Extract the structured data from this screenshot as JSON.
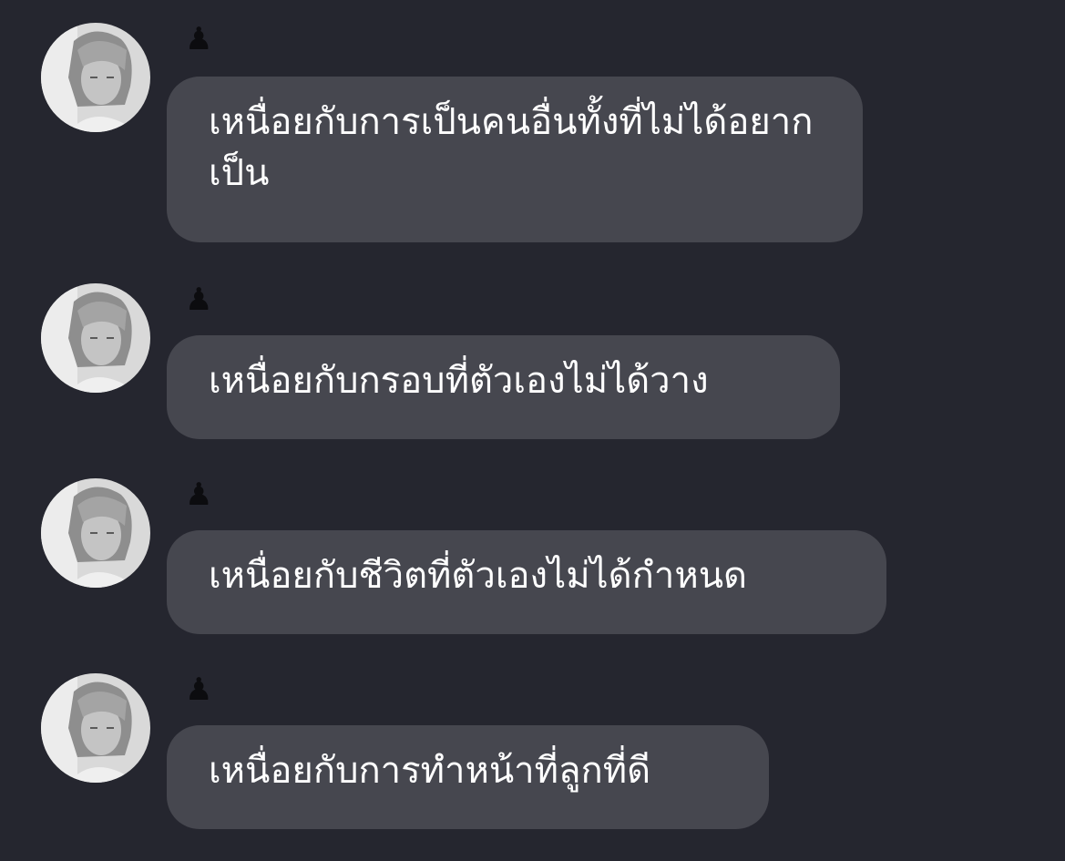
{
  "messages": [
    {
      "sender": "♟",
      "text": "เหนื่อยกับการเป็นคนอื่นทั้งที่ไม่ได้อยากเป็น"
    },
    {
      "sender": "♟",
      "text": "เหนื่อยกับกรอบที่ตัวเองไม่ได้วาง"
    },
    {
      "sender": "♟",
      "text": "เหนื่อยกับชีวิตที่ตัวเองไม่ได้กำหนด"
    },
    {
      "sender": "♟",
      "text": "เหนื่อยกับการทำหน้าที่ลูกที่ดี"
    }
  ]
}
